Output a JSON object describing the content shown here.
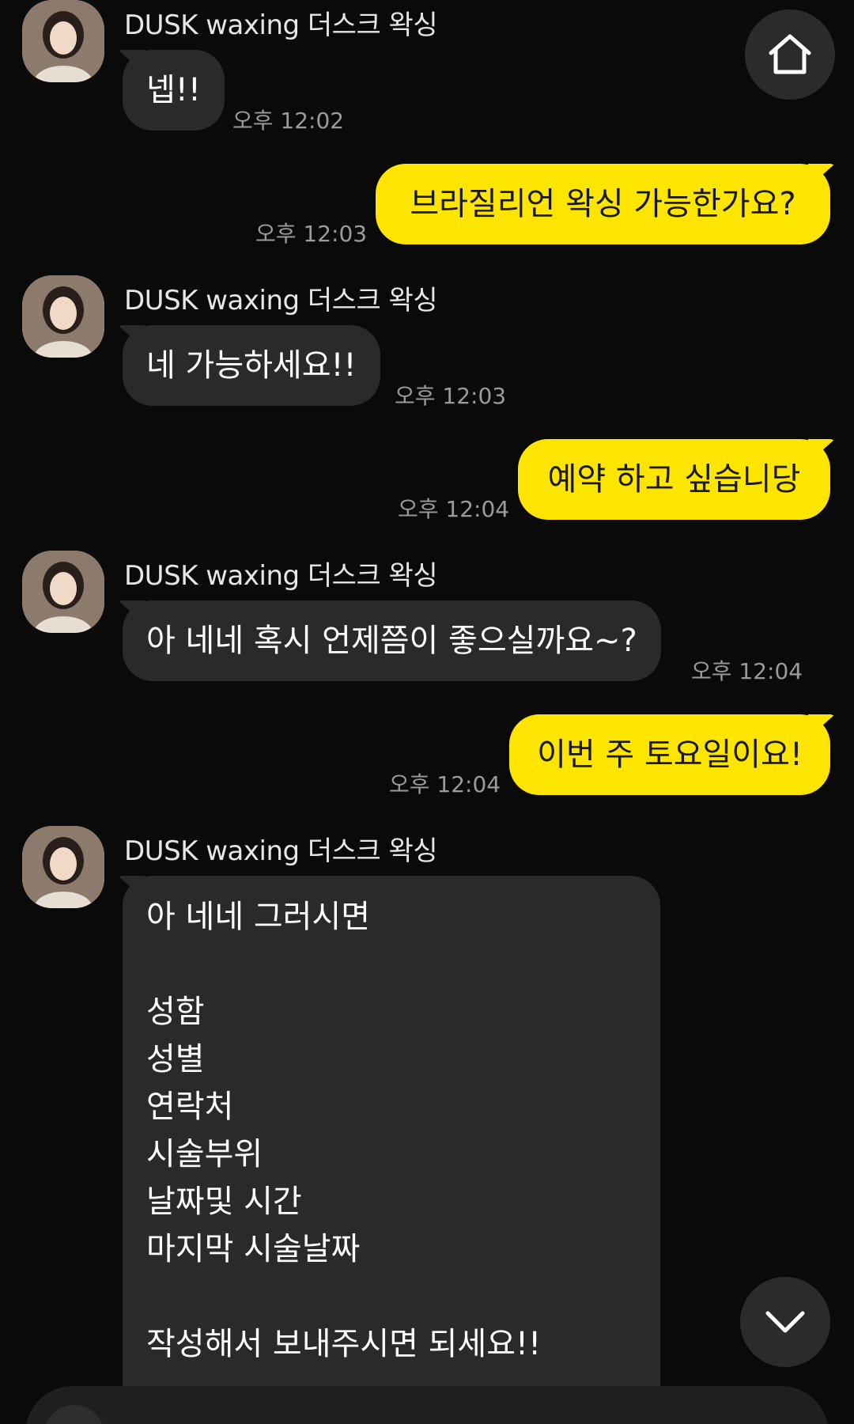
{
  "chat": {
    "messages": [
      {
        "sender": "DUSK waxing 더스크 왁싱",
        "text": "넵!!",
        "time": "오후 12:02"
      },
      {
        "text": "브라질리언 왁싱 가능한가요?",
        "time": "오후 12:03"
      },
      {
        "sender": "DUSK waxing 더스크 왁싱",
        "text": "네 가능하세요!!",
        "time": "오후 12:03"
      },
      {
        "text": "예약 하고 싶습니당",
        "time": "오후 12:04"
      },
      {
        "sender": "DUSK waxing 더스크 왁싱",
        "text": "아 네네 혹시 언제쯤이 좋으실까요~?",
        "time": "오후 12:04"
      },
      {
        "text": "이번 주 토요일이요!",
        "time": "오후 12:04"
      },
      {
        "sender": "DUSK waxing 더스크 왁싱",
        "lines": [
          "아 네네 그러시면",
          "",
          "성함",
          "성별",
          "연락처",
          "시술부위",
          "날짜및 시간",
          "마지막 시술날짜",
          "",
          "작성해서 보내주시면 되세요!!"
        ]
      }
    ]
  },
  "icons": {
    "home": "home-icon",
    "scroll_down": "chevron-down-icon",
    "avatar": "avatar"
  },
  "colors": {
    "background": "#0a0a0a",
    "incoming_bubble": "#2a2a2a",
    "outgoing_bubble": "#fee500",
    "timestamp": "#9b9b9b"
  }
}
